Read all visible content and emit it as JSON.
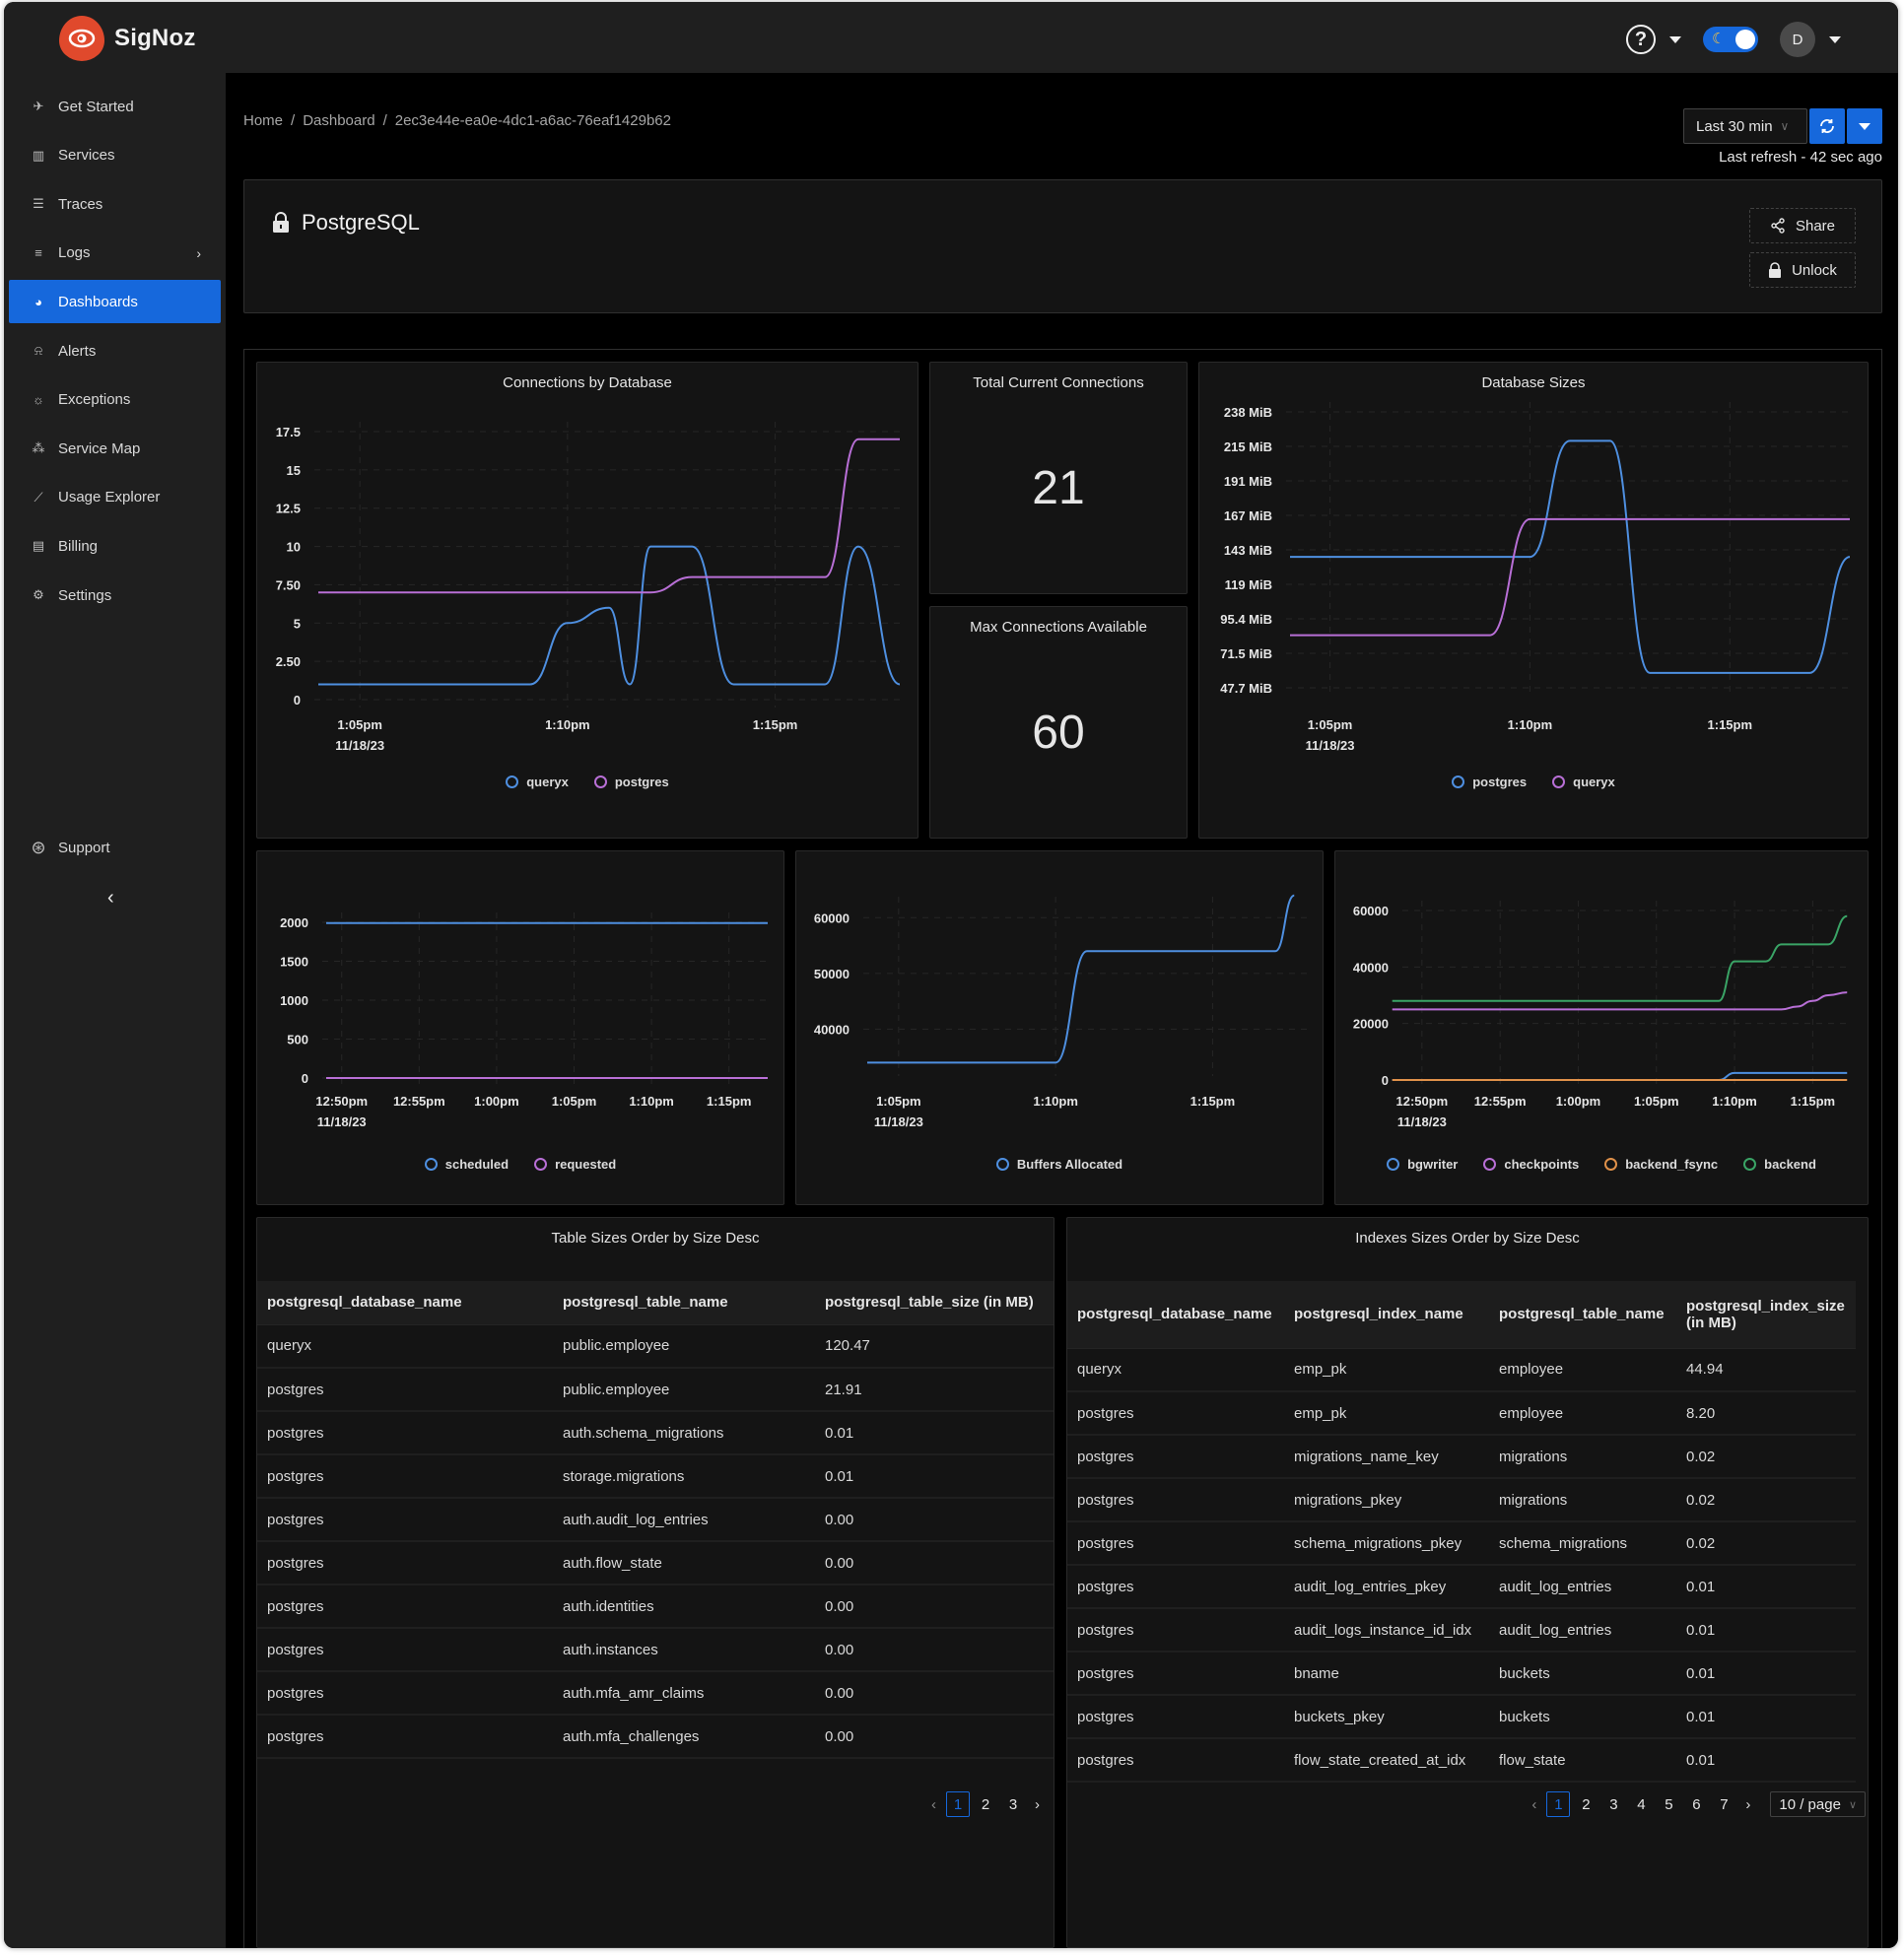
{
  "app": {
    "name": "SigNoz",
    "brand_color": "#e0492c",
    "accent_color": "#1668dc"
  },
  "topbar": {
    "help_icon": "question-circle-icon",
    "theme_toggle": "dark",
    "avatar_initial": "D"
  },
  "sidebar": {
    "items": [
      {
        "label": "Get Started",
        "icon": "rocket-icon",
        "active": false
      },
      {
        "label": "Services",
        "icon": "bar-chart-icon",
        "active": false
      },
      {
        "label": "Traces",
        "icon": "menu-icon",
        "active": false
      },
      {
        "label": "Logs",
        "icon": "align-left-icon",
        "active": false,
        "has_submenu": true
      },
      {
        "label": "Dashboards",
        "icon": "dashboard-icon",
        "active": true
      },
      {
        "label": "Alerts",
        "icon": "alert-icon",
        "active": false
      },
      {
        "label": "Exceptions",
        "icon": "bug-icon",
        "active": false
      },
      {
        "label": "Service Map",
        "icon": "deployment-unit-icon",
        "active": false
      },
      {
        "label": "Usage Explorer",
        "icon": "line-chart-icon",
        "active": false
      },
      {
        "label": "Billing",
        "icon": "billing-icon",
        "active": false
      },
      {
        "label": "Settings",
        "icon": "settings-icon",
        "active": false
      }
    ],
    "support_label": "Support"
  },
  "breadcrumb": {
    "items": [
      "Home",
      "Dashboard",
      "2ec3e44e-ea0e-4dc1-a6ac-76eaf1429b62"
    ],
    "separator": "/"
  },
  "time_control": {
    "selected": "Last 30 min",
    "last_refresh": "Last refresh - 42 sec ago"
  },
  "dashboard": {
    "title": "PostgreSQL",
    "locked": true,
    "share_label": "Share",
    "unlock_label": "Unlock"
  },
  "stats": {
    "total_connections": {
      "title": "Total Current Connections",
      "value": "21"
    },
    "max_connections": {
      "title": "Max Connections Available",
      "value": "60"
    }
  },
  "chart_data": [
    {
      "id": "connections",
      "type": "line",
      "title": "Connections by Database",
      "xlabel": "",
      "ylabel": "",
      "x_ticks": [
        "1:05pm",
        "1:10pm",
        "1:15pm"
      ],
      "x_date": "11/18/23",
      "y_ticks": [
        "0",
        "2.50",
        "5",
        "7.50",
        "10",
        "12.5",
        "15",
        "17.5"
      ],
      "xlim": [
        -1,
        13
      ],
      "ylim": [
        0,
        17.5
      ],
      "grid": true,
      "legend_position": "bottom",
      "x": [
        -1,
        0,
        1,
        2,
        3,
        4,
        4.1,
        5,
        6,
        6.5,
        7,
        8,
        9,
        10,
        11,
        11.2,
        12,
        13
      ],
      "series": [
        {
          "name": "queryx",
          "color": "#4e8fe0",
          "values": [
            1,
            1,
            1,
            1,
            1,
            1,
            1,
            5,
            6,
            1,
            10,
            10,
            1,
            1,
            1,
            1,
            10,
            1
          ]
        },
        {
          "name": "postgres",
          "color": "#b86fd6",
          "values": [
            7,
            7,
            7,
            7,
            7,
            7,
            7,
            7,
            7,
            7,
            7,
            8,
            8,
            8,
            8,
            8,
            17,
            17
          ]
        }
      ]
    },
    {
      "id": "db_sizes",
      "type": "line",
      "title": "Database Sizes",
      "xlabel": "",
      "ylabel": "",
      "x_ticks": [
        "1:05pm",
        "1:10pm",
        "1:15pm"
      ],
      "x_date": "11/18/23",
      "y_ticks": [
        "47.7 MiB",
        "71.5 MiB",
        "95.4 MiB",
        "119 MiB",
        "143 MiB",
        "167 MiB",
        "191 MiB",
        "215 MiB",
        "238 MiB"
      ],
      "xlim": [
        -1,
        13
      ],
      "ylim": [
        47.7,
        238
      ],
      "grid": true,
      "legend_position": "bottom",
      "x": [
        -1,
        0,
        1,
        2,
        3,
        4,
        5,
        6,
        7,
        8,
        9,
        10,
        11,
        12,
        13
      ],
      "series": [
        {
          "name": "postgres",
          "color": "#4e8fe0",
          "values": [
            138,
            138,
            138,
            138,
            138,
            138,
            138,
            218,
            218,
            58,
            58,
            58,
            58,
            58,
            138
          ]
        },
        {
          "name": "queryx",
          "color": "#b86fd6",
          "values": [
            84,
            84,
            84,
            84,
            84,
            84,
            164,
            164,
            164,
            164,
            164,
            164,
            164,
            164,
            164
          ]
        }
      ]
    },
    {
      "id": "bgworker",
      "type": "line",
      "title": "",
      "xlabel": "",
      "ylabel": "",
      "x_ticks": [
        "12:50pm",
        "12:55pm",
        "1:00pm",
        "1:05pm",
        "1:10pm",
        "1:15pm"
      ],
      "x_date": "11/18/23",
      "y_ticks": [
        "0",
        "500",
        "1000",
        "1500",
        "2000"
      ],
      "xlim": [
        0,
        28.5
      ],
      "ylim": [
        0,
        2000
      ],
      "grid": true,
      "legend_position": "bottom",
      "x": [
        0,
        28.5
      ],
      "series": [
        {
          "name": "scheduled",
          "color": "#4e8fe0",
          "values": [
            1990,
            1990
          ]
        },
        {
          "name": "requested",
          "color": "#b86fd6",
          "values": [
            0,
            0
          ]
        }
      ]
    },
    {
      "id": "buffers",
      "type": "line",
      "title": "",
      "xlabel": "",
      "ylabel": "",
      "x_ticks": [
        "1:05pm",
        "1:10pm",
        "1:15pm"
      ],
      "x_date": "11/18/23",
      "y_ticks": [
        "40000",
        "50000",
        "60000"
      ],
      "xlim": [
        -1,
        13
      ],
      "ylim": [
        33000,
        62000
      ],
      "grid": true,
      "legend_position": "bottom",
      "x": [
        -1,
        0,
        1,
        2,
        3,
        4,
        5,
        6,
        7,
        8,
        9,
        10,
        11,
        12,
        12.6
      ],
      "series": [
        {
          "name": "Buffers Allocated",
          "color": "#4e8fe0",
          "values": [
            34000,
            34000,
            34000,
            34000,
            34000,
            34000,
            34000,
            54000,
            54000,
            54000,
            54000,
            54000,
            54000,
            54000,
            64000
          ]
        }
      ]
    },
    {
      "id": "buffers_written",
      "type": "line",
      "title": "",
      "xlabel": "",
      "ylabel": "",
      "x_ticks": [
        "12:50pm",
        "12:55pm",
        "1:00pm",
        "1:05pm",
        "1:10pm",
        "1:15pm"
      ],
      "x_date": "11/18/23",
      "y_ticks": [
        "0",
        "20000",
        "40000",
        "60000"
      ],
      "xlim": [
        0,
        28.5
      ],
      "ylim": [
        0,
        60000
      ],
      "grid": true,
      "legend_position": "bottom",
      "x": [
        -0.9,
        20,
        21,
        22,
        23,
        24,
        25,
        26,
        27,
        28.2
      ],
      "series": [
        {
          "name": "bgwriter",
          "color": "#4e8fe0",
          "values": [
            0,
            0,
            2500,
            2500,
            2500,
            2500,
            2500,
            2500,
            2500,
            2500
          ]
        },
        {
          "name": "checkpoints",
          "color": "#b86fd6",
          "values": [
            25000,
            25000,
            25000,
            25000,
            25000,
            25000,
            26000,
            28000,
            30000,
            31000
          ]
        },
        {
          "name": "backend_fsync",
          "color": "#e0914a",
          "values": [
            0,
            0,
            0,
            0,
            0,
            0,
            0,
            0,
            0,
            0
          ]
        },
        {
          "name": "backend",
          "color": "#3aa466",
          "values": [
            28000,
            28000,
            42000,
            42000,
            42000,
            48000,
            48000,
            48000,
            48000,
            58000
          ]
        }
      ]
    }
  ],
  "table_sizes": {
    "title": "Table Sizes Order by Size Desc",
    "columns": [
      "postgresql_database_name",
      "postgresql_table_name",
      "postgresql_table_size (in MB)"
    ],
    "rows": [
      [
        "queryx",
        "public.employee",
        "120.47"
      ],
      [
        "postgres",
        "public.employee",
        "21.91"
      ],
      [
        "postgres",
        "auth.schema_migrations",
        "0.01"
      ],
      [
        "postgres",
        "storage.migrations",
        "0.01"
      ],
      [
        "postgres",
        "auth.audit_log_entries",
        "0.00"
      ],
      [
        "postgres",
        "auth.flow_state",
        "0.00"
      ],
      [
        "postgres",
        "auth.identities",
        "0.00"
      ],
      [
        "postgres",
        "auth.instances",
        "0.00"
      ],
      [
        "postgres",
        "auth.mfa_amr_claims",
        "0.00"
      ],
      [
        "postgres",
        "auth.mfa_challenges",
        "0.00"
      ]
    ],
    "pagination": {
      "pages": [
        "1",
        "2",
        "3"
      ],
      "current": "1"
    }
  },
  "index_sizes": {
    "title": "Indexes Sizes Order by Size Desc",
    "columns": [
      "postgresql_database_name",
      "postgresql_index_name",
      "postgresql_table_name",
      "postgresql_index_size (in MB)"
    ],
    "rows": [
      [
        "queryx",
        "emp_pk",
        "employee",
        "44.94"
      ],
      [
        "postgres",
        "emp_pk",
        "employee",
        "8.20"
      ],
      [
        "postgres",
        "migrations_name_key",
        "migrations",
        "0.02"
      ],
      [
        "postgres",
        "migrations_pkey",
        "migrations",
        "0.02"
      ],
      [
        "postgres",
        "schema_migrations_pkey",
        "schema_migrations",
        "0.02"
      ],
      [
        "postgres",
        "audit_log_entries_pkey",
        "audit_log_entries",
        "0.01"
      ],
      [
        "postgres",
        "audit_logs_instance_id_idx",
        "audit_log_entries",
        "0.01"
      ],
      [
        "postgres",
        "bname",
        "buckets",
        "0.01"
      ],
      [
        "postgres",
        "buckets_pkey",
        "buckets",
        "0.01"
      ],
      [
        "postgres",
        "flow_state_created_at_idx",
        "flow_state",
        "0.01"
      ]
    ],
    "pagination": {
      "pages": [
        "1",
        "2",
        "3",
        "4",
        "5",
        "6",
        "7"
      ],
      "current": "1",
      "page_size": "10 / page"
    }
  }
}
